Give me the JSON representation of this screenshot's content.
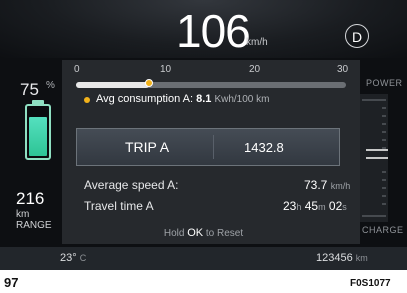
{
  "speed": {
    "value": "106",
    "unit": "km/h"
  },
  "gear": "D",
  "battery": {
    "percent": "75",
    "percent_symbol": "%",
    "fill_fraction": 0.75,
    "color": "#3ad1a6"
  },
  "range": {
    "value": "216",
    "unit": "km",
    "label": "RANGE"
  },
  "power_gauge": {
    "top_label": "POWER",
    "bottom_label": "CHARGE"
  },
  "consumption_scale": {
    "ticks": [
      "0",
      "10",
      "20",
      "30"
    ],
    "min": 0,
    "max": 30,
    "value": 8.1,
    "indicator_color": "#f2b21b",
    "label": "Avg consumption A:",
    "value_text": "8.1",
    "unit": "Kwh/100  km"
  },
  "trip": {
    "label": "TRIP A",
    "distance": "1432.8"
  },
  "stats": {
    "avg_speed_label": "Average speed A:",
    "avg_speed_value": "73.7",
    "avg_speed_unit": "km/h",
    "travel_time_label": "Travel time A",
    "hours": "23",
    "h_unit": "h",
    "minutes": "45",
    "m_unit": "m",
    "seconds": "02",
    "s_unit": "s"
  },
  "hint": {
    "pre": "Hold",
    "key": "OK",
    "post": "to Reset"
  },
  "bottom": {
    "temperature": "23°",
    "temp_unit": "C",
    "odometer": "123456",
    "odo_unit": "km"
  },
  "caption": {
    "left": "97",
    "right": "F0S1077"
  }
}
